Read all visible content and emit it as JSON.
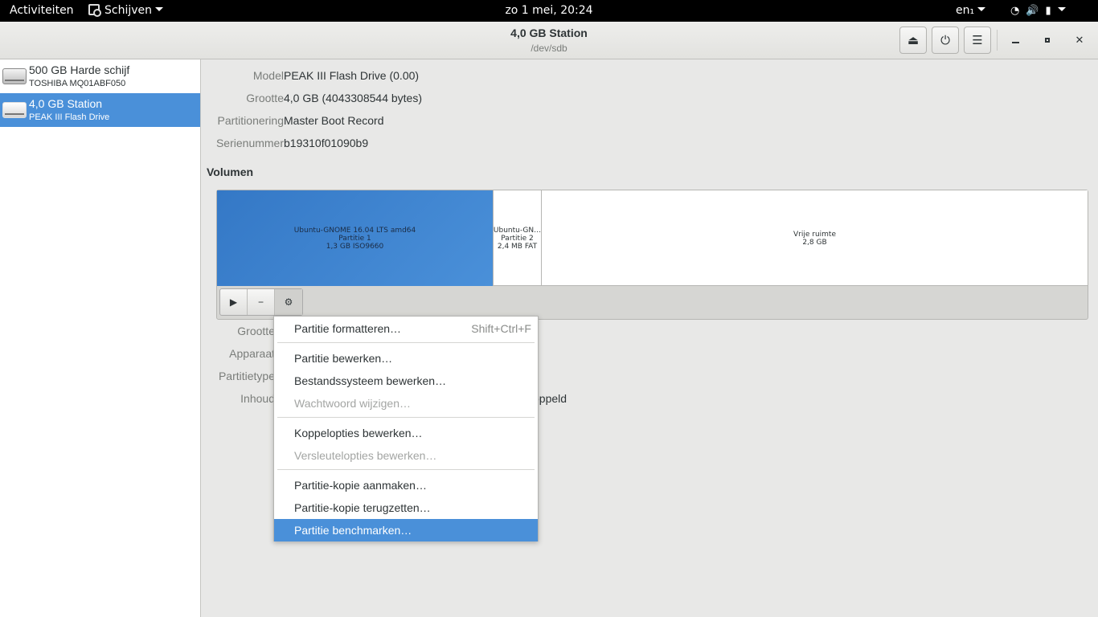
{
  "topbar": {
    "activities": "Activiteiten",
    "app_menu": "Schijven",
    "clock": "zo  1 mei, 20:24",
    "keyboard": "en₁"
  },
  "header": {
    "title": "4,0 GB Station",
    "subtitle": "/dev/sdb"
  },
  "sidebar": {
    "drives": [
      {
        "name": "500 GB Harde schijf",
        "model": "TOSHIBA MQ01ABF050"
      },
      {
        "name": "4,0 GB Station",
        "model": "PEAK III Flash Drive"
      }
    ]
  },
  "details": {
    "model_label": "Model",
    "model_value": "PEAK III Flash Drive (0.00)",
    "size_label": "Grootte",
    "size_value": "4,0 GB (4043308544 bytes)",
    "partitioning_label": "Partitionering",
    "partitioning_value": "Master Boot Record",
    "serial_label": "Serienummer",
    "serial_value": "b19310f01090b9"
  },
  "volumes": {
    "title": "Volumen",
    "partitions": [
      {
        "line1": "Ubuntu-GNOME 16.04 LTS amd64",
        "line2": "Partitie 1",
        "line3": "1,3 GB ISO9660"
      },
      {
        "line1": "Ubuntu-GN…",
        "line2": "Partitie 2",
        "line3": "2,4 MB FAT"
      },
      {
        "line1": "Vrije ruimte",
        "line2": "2,8 GB"
      }
    ]
  },
  "partition_details": {
    "size_label": "Grootte",
    "device_label": "Apparaat",
    "type_label": "Partitietype",
    "content_label": "Inhoud",
    "content_value_tail": "oppeld"
  },
  "menu": {
    "format": "Partitie formatteren…",
    "format_accel": "Shift+Ctrl+F",
    "edit_partition": "Partitie bewerken…",
    "edit_filesystem": "Bestandssysteem bewerken…",
    "change_password": "Wachtwoord wijzigen…",
    "edit_mount": "Koppelopties bewerken…",
    "edit_encryption": "Versleutelopties bewerken…",
    "create_image": "Partitie-kopie aanmaken…",
    "restore_image": "Partitie-kopie terugzetten…",
    "benchmark": "Partitie benchmarken…"
  }
}
